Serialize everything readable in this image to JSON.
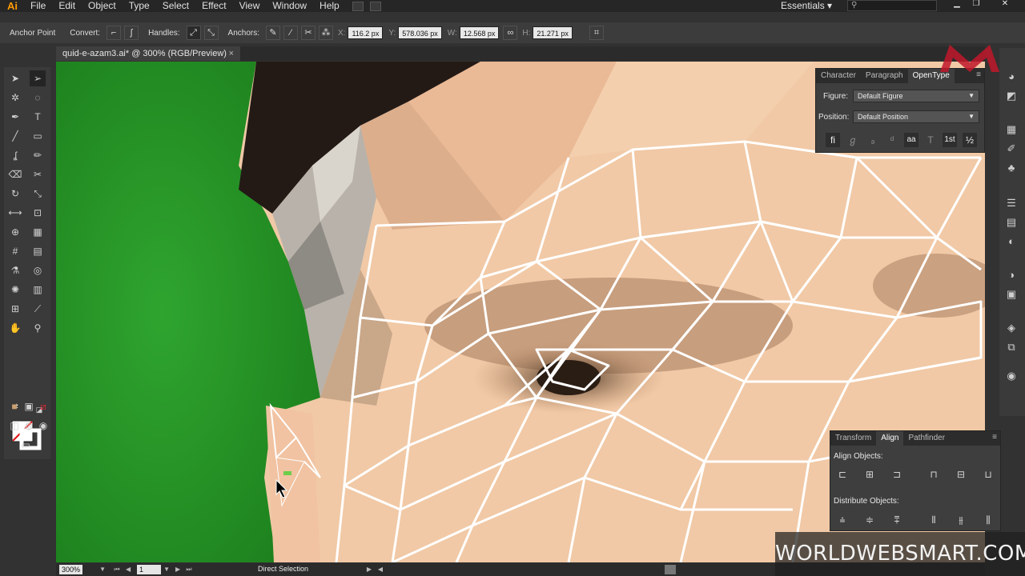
{
  "menubar": {
    "app_logo": "Ai",
    "items": [
      "File",
      "Edit",
      "Object",
      "Type",
      "Select",
      "Effect",
      "View",
      "Window",
      "Help"
    ],
    "workspace": "Essentials",
    "workspace_arrow": "▾"
  },
  "controlbar": {
    "anchor_point_label": "Anchor Point",
    "convert_label": "Convert:",
    "handles_label": "Handles:",
    "anchors_label": "Anchors:",
    "x_label": "X:",
    "x_value": "116.2 px",
    "y_label": "Y:",
    "y_value": "578.036 px",
    "w_label": "W:",
    "w_value": "12.568 px",
    "h_label": "H:",
    "h_value": "21.271 px"
  },
  "document": {
    "tab_title": "quid-e-azam3.ai* @ 300% (RGB/Preview)",
    "close_glyph": "×"
  },
  "character_panel": {
    "tabs": [
      "Character",
      "Paragraph",
      "OpenType"
    ],
    "active_tab": "OpenType",
    "figure_label": "Figure:",
    "figure_value": "Default Figure",
    "position_label": "Position:",
    "position_value": "Default Position",
    "glyphs": [
      "ﬁ",
      "ℊ",
      "ₔ",
      "ᵈ",
      "aa",
      "T",
      "1st",
      "½"
    ]
  },
  "align_panel": {
    "tabs": [
      "Transform",
      "Align",
      "Pathfinder"
    ],
    "active_tab": "Align",
    "align_objects_label": "Align Objects:",
    "distribute_objects_label": "Distribute Objects:"
  },
  "statusbar": {
    "zoom": "300%",
    "artboard": "1",
    "tool_name": "Direct Selection"
  },
  "watermark": "WORLDWEBSMART.COM",
  "colors": {
    "background_green": "#2a9a2a",
    "skin": "#f1c9a6",
    "mesh_lines": "#ffffff",
    "ai_orange": "#ff9a00",
    "brand_red": "#c0182a"
  }
}
